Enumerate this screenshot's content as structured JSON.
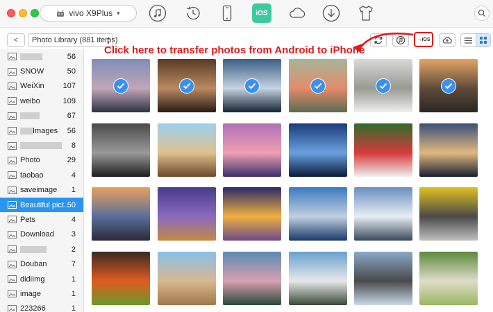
{
  "titlebar": {
    "device_name": "vivo X9Plus",
    "ios_label": "iOS",
    "icons": [
      "music-icon",
      "history-icon",
      "phone-icon",
      "ios-icon",
      "cloud-icon",
      "download-icon",
      "tshirt-icon",
      "search-icon"
    ]
  },
  "toolbar": {
    "back_label": "<",
    "library_select": "Photo Library (881 items)",
    "to_ios_label": "→iOS"
  },
  "annotation": {
    "text": "Click here to transfer photos from Android to iPhone",
    "color": "#e21a1a"
  },
  "sidebar": {
    "selected_color": "#2a95ee",
    "albums": [
      {
        "name": "",
        "count": "56",
        "redacted": true
      },
      {
        "name": "SNOW",
        "count": "50"
      },
      {
        "name": "WeiXin",
        "count": "107"
      },
      {
        "name": "weibo",
        "count": "109"
      },
      {
        "name": "",
        "count": "67",
        "redacted": true
      },
      {
        "name": "Images",
        "count": "56",
        "redacted_prefix": true
      },
      {
        "name": "",
        "count": "8",
        "redacted": true
      },
      {
        "name": "Photo",
        "count": "29"
      },
      {
        "name": "taobao",
        "count": "4"
      },
      {
        "name": "saveimage",
        "count": "1"
      },
      {
        "name": "Beautiful pict...",
        "count": "50",
        "selected": true
      },
      {
        "name": "Pets",
        "count": "4"
      },
      {
        "name": "Download",
        "count": "3"
      },
      {
        "name": "",
        "count": "2",
        "redacted": true
      },
      {
        "name": "Douban",
        "count": "7"
      },
      {
        "name": "didiImg",
        "count": "1"
      },
      {
        "name": "image",
        "count": "1"
      },
      {
        "name": "223266",
        "count": "1"
      }
    ]
  },
  "photos": [
    {
      "subject": "mountain-lake-sunset",
      "selected": true,
      "colors": [
        "#7f8db7",
        "#c2a6b8",
        "#2c3342"
      ]
    },
    {
      "subject": "latte-coffee",
      "selected": true,
      "colors": [
        "#5a3a24",
        "#b98a62",
        "#2a1a10"
      ]
    },
    {
      "subject": "snow-mountain-lake",
      "selected": true,
      "colors": [
        "#3b5f86",
        "#c6d3e0",
        "#142233"
      ]
    },
    {
      "subject": "tulips-vase",
      "selected": true,
      "colors": [
        "#a6b59a",
        "#e48b6b",
        "#5c6b50"
      ]
    },
    {
      "subject": "white-armchair",
      "selected": true,
      "colors": [
        "#d9d9d6",
        "#9a9a94",
        "#efefec"
      ]
    },
    {
      "subject": "railway-sunset",
      "selected": true,
      "colors": [
        "#e4a565",
        "#5e4b3a",
        "#2c2622"
      ]
    },
    {
      "subject": "french-horn",
      "selected": false,
      "colors": [
        "#4a4a4a",
        "#9a9a9a",
        "#1e1e1e"
      ]
    },
    {
      "subject": "windmill",
      "selected": false,
      "colors": [
        "#9bd0f0",
        "#e0c08e",
        "#6a4a2a"
      ]
    },
    {
      "subject": "pink-sunset-sea",
      "selected": false,
      "colors": [
        "#b070b8",
        "#f0a0b0",
        "#3a3070"
      ]
    },
    {
      "subject": "city-night-skyline",
      "selected": false,
      "colors": [
        "#1c3c7a",
        "#6aa0e0",
        "#0a1a3a"
      ]
    },
    {
      "subject": "strawberries-bowl",
      "selected": false,
      "colors": [
        "#2e6d2e",
        "#d63a3a",
        "#f0f0f0"
      ]
    },
    {
      "subject": "harbor-dusk",
      "selected": false,
      "colors": [
        "#3a5078",
        "#e0b880",
        "#1a2030"
      ]
    },
    {
      "subject": "empire-state-building",
      "selected": false,
      "colors": [
        "#e8a060",
        "#5a6e9a",
        "#2a2a3a"
      ]
    },
    {
      "subject": "purple-flowers-basket",
      "selected": false,
      "colors": [
        "#4a3a8a",
        "#8a6ac0",
        "#c08a40"
      ]
    },
    {
      "subject": "palace-night-reflection",
      "selected": false,
      "colors": [
        "#2a2a6a",
        "#f0b040",
        "#6a4a8a"
      ]
    },
    {
      "subject": "skyscraper-blue",
      "selected": false,
      "colors": [
        "#3a7ac0",
        "#c0d0e0",
        "#1a3a6a"
      ]
    },
    {
      "subject": "snowy-alps-village",
      "selected": false,
      "colors": [
        "#6a90c0",
        "#e8eef4",
        "#3a4a5a"
      ]
    },
    {
      "subject": "yellow-sports-car",
      "selected": false,
      "colors": [
        "#e0c020",
        "#4a4a4a",
        "#c0c0c0"
      ]
    },
    {
      "subject": "tomato-limes",
      "selected": false,
      "colors": [
        "#3a2a20",
        "#e05a20",
        "#6a9a2a"
      ]
    },
    {
      "subject": "sphinx-pyramid",
      "selected": false,
      "colors": [
        "#8ac0e8",
        "#d8b890",
        "#a0784a"
      ]
    },
    {
      "subject": "mountain-lake-pink",
      "selected": false,
      "colors": [
        "#5a8ab0",
        "#d8a0b0",
        "#2a4a3a"
      ]
    },
    {
      "subject": "lighthouse-coast",
      "selected": false,
      "colors": [
        "#6aa0d0",
        "#e8e8e8",
        "#3a4a3a"
      ]
    },
    {
      "subject": "coastal-rocks",
      "selected": false,
      "colors": [
        "#8aa8c8",
        "#4a4a4a",
        "#c8d8e8"
      ]
    },
    {
      "subject": "matcha-tea",
      "selected": false,
      "colors": [
        "#5a8a3a",
        "#e0dcc8",
        "#9ab860"
      ]
    }
  ]
}
